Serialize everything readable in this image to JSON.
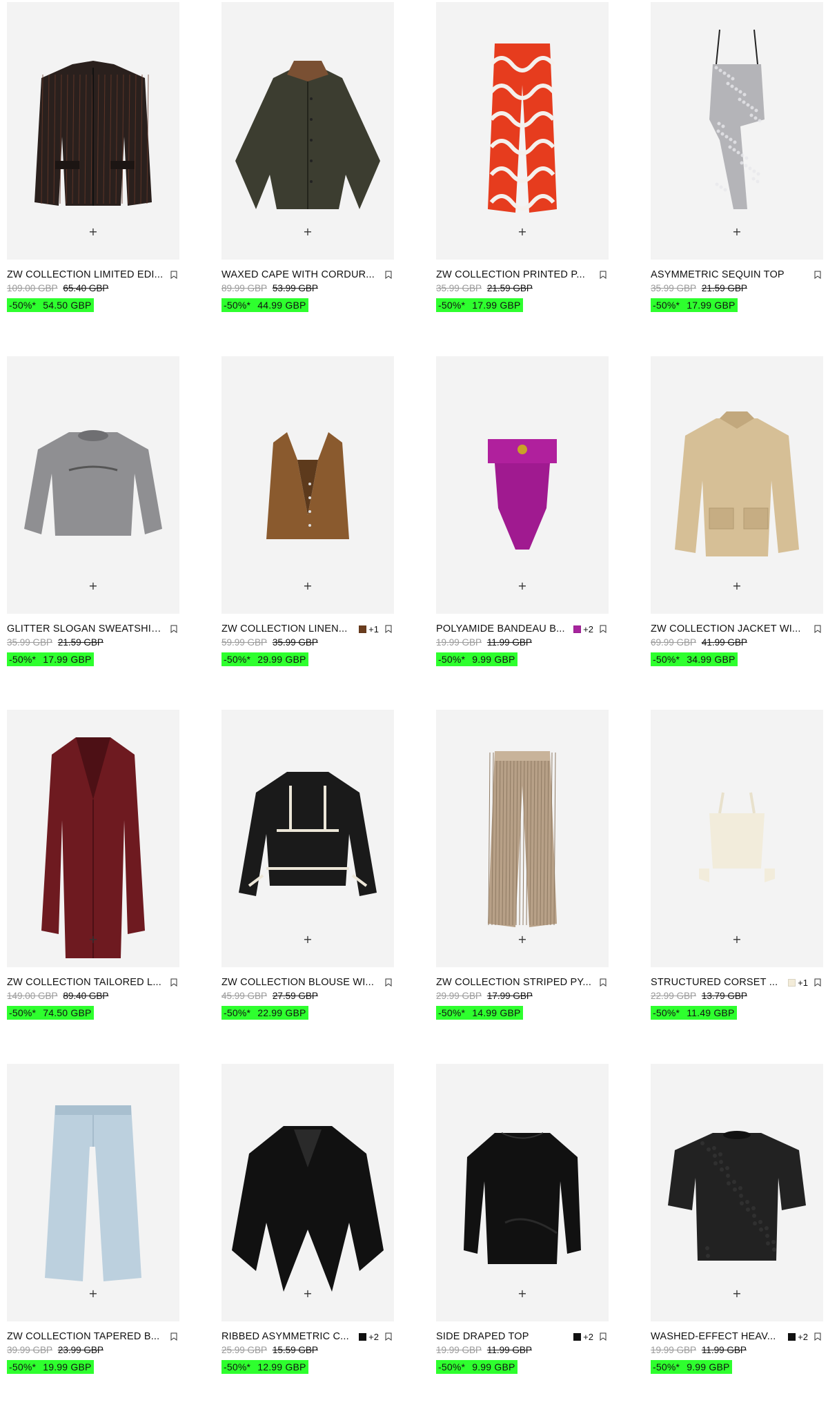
{
  "accent": "#2eff2e",
  "products": [
    {
      "name": "ZW COLLECTION LIMITED EDI...",
      "original_price": "109.00 GBP",
      "was_price": "65.40 GBP",
      "discount": "-50%*",
      "sale_price": "54.50 GBP",
      "image": "pinstripe-blazer-dark"
    },
    {
      "name": "WAXED CAPE WITH CORDUR...",
      "original_price": "89.99 GBP",
      "was_price": "53.99 GBP",
      "discount": "-50%*",
      "sale_price": "44.99 GBP",
      "image": "waxed-cape-olive"
    },
    {
      "name": "ZW COLLECTION PRINTED P...",
      "original_price": "35.99 GBP",
      "was_price": "21.59 GBP",
      "discount": "-50%*",
      "sale_price": "17.99 GBP",
      "image": "printed-trousers-red"
    },
    {
      "name": "ASYMMETRIC SEQUIN TOP",
      "original_price": "35.99 GBP",
      "was_price": "21.59 GBP",
      "discount": "-50%*",
      "sale_price": "17.99 GBP",
      "image": "sequin-top-silver"
    },
    {
      "name": "GLITTER SLOGAN SWEATSHIRT",
      "original_price": "35.99 GBP",
      "was_price": "21.59 GBP",
      "discount": "-50%*",
      "sale_price": "17.99 GBP",
      "image": "sweatshirt-grey"
    },
    {
      "name": "ZW COLLECTION LINEN...",
      "swatch_color": "#6b3d1e",
      "more_colors": "+1",
      "original_price": "59.99 GBP",
      "was_price": "35.99 GBP",
      "discount": "-50%*",
      "sale_price": "29.99 GBP",
      "image": "linen-waistcoat-brown"
    },
    {
      "name": "POLYAMIDE BANDEAU B...",
      "swatch_color": "#a8249e",
      "more_colors": "+2",
      "original_price": "19.99 GBP",
      "was_price": "11.99 GBP",
      "discount": "-50%*",
      "sale_price": "9.99 GBP",
      "image": "bandeau-bodysuit-magenta"
    },
    {
      "name": "ZW COLLECTION JACKET WI...",
      "original_price": "69.99 GBP",
      "was_price": "41.99 GBP",
      "discount": "-50%*",
      "sale_price": "34.99 GBP",
      "image": "jacket-beige"
    },
    {
      "name": "ZW COLLECTION TAILORED L...",
      "original_price": "149.00 GBP",
      "was_price": "89.40 GBP",
      "discount": "-50%*",
      "sale_price": "74.50 GBP",
      "image": "tailored-coat-burgundy"
    },
    {
      "name": "ZW COLLECTION BLOUSE WI...",
      "original_price": "45.99 GBP",
      "was_price": "27.59 GBP",
      "discount": "-50%*",
      "sale_price": "22.99 GBP",
      "image": "blouse-black-contrast"
    },
    {
      "name": "ZW COLLECTION STRIPED PY...",
      "original_price": "29.99 GBP",
      "was_price": "17.99 GBP",
      "discount": "-50%*",
      "sale_price": "14.99 GBP",
      "image": "striped-trousers-beige"
    },
    {
      "name": "STRUCTURED CORSET ...",
      "swatch_color": "#f3ecd9",
      "more_colors": "+1",
      "original_price": "22.99 GBP",
      "was_price": "13.79 GBP",
      "discount": "-50%*",
      "sale_price": "11.49 GBP",
      "image": "corset-top-cream"
    },
    {
      "name": "ZW COLLECTION TAPERED B...",
      "original_price": "39.99 GBP",
      "was_price": "23.99 GBP",
      "discount": "-50%*",
      "sale_price": "19.99 GBP",
      "image": "tapered-jeans-light"
    },
    {
      "name": "RIBBED ASYMMETRIC C...",
      "swatch_color": "#111111",
      "more_colors": "+2",
      "original_price": "25.99 GBP",
      "was_price": "15.59 GBP",
      "discount": "-50%*",
      "sale_price": "12.99 GBP",
      "image": "asymmetric-cardigan-black"
    },
    {
      "name": "SIDE DRAPED TOP",
      "swatch_color": "#111111",
      "more_colors": "+2",
      "original_price": "19.99 GBP",
      "was_price": "11.99 GBP",
      "discount": "-50%*",
      "sale_price": "9.99 GBP",
      "image": "draped-top-black"
    },
    {
      "name": "WASHED-EFFECT HEAV...",
      "swatch_color": "#111111",
      "more_colors": "+2",
      "original_price": "19.99 GBP",
      "was_price": "11.99 GBP",
      "discount": "-50%*",
      "sale_price": "9.99 GBP",
      "image": "washed-tshirt-black"
    }
  ],
  "icons": {
    "add": "+",
    "bookmark": "bookmark-icon"
  }
}
